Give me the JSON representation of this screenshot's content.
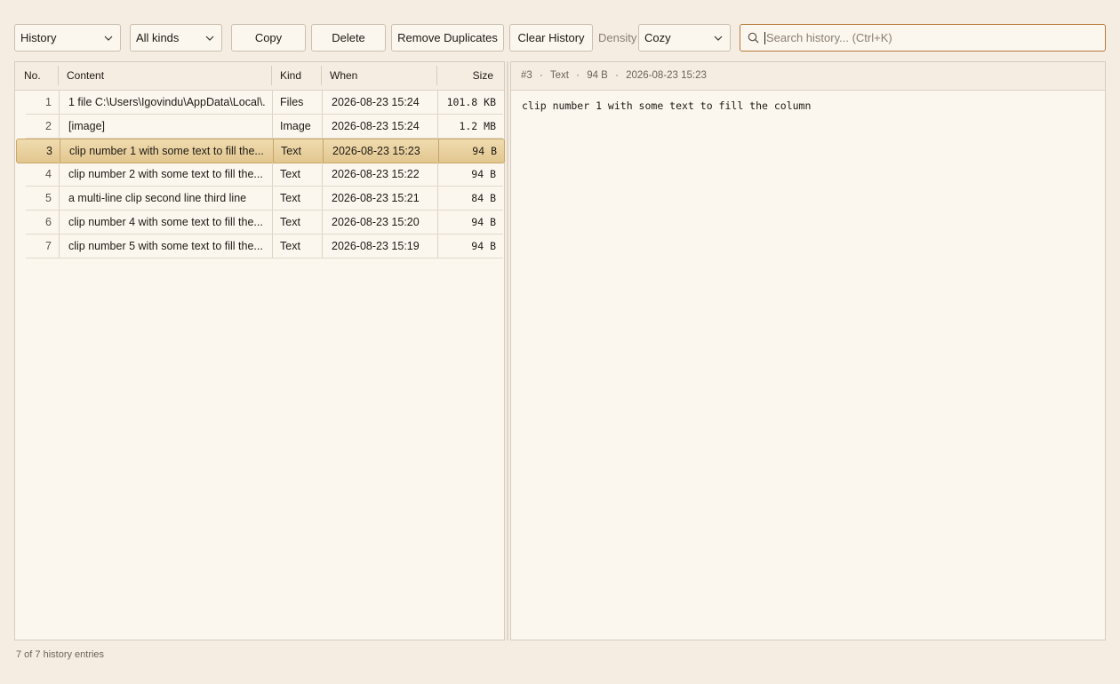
{
  "toolbar": {
    "view_select": "History",
    "kind_select": "All kinds",
    "copy_label": "Copy",
    "delete_label": "Delete",
    "remove_dup_label": "Remove Duplicates",
    "clear_label": "Clear History",
    "density_label": "Density",
    "density_select": "Cozy",
    "search_placeholder": "Search history... (Ctrl+K)"
  },
  "table": {
    "headers": [
      "No.",
      "Content",
      "Kind",
      "When",
      "Size"
    ],
    "rows": [
      {
        "no": "1",
        "content": "1 file C:\\Users\\Igovindu\\AppData\\Local\\...",
        "kind": "Files",
        "when": "2026-08-23 15:24",
        "size": "101.8 KB"
      },
      {
        "no": "2",
        "content": "[image]",
        "kind": "Image",
        "when": "2026-08-23 15:24",
        "size": "1.2 MB"
      },
      {
        "no": "3",
        "content": "clip number 1 with some text to fill the...",
        "kind": "Text",
        "when": "2026-08-23 15:23",
        "size": "94 B"
      },
      {
        "no": "4",
        "content": "clip number 2 with some text to fill the...",
        "kind": "Text",
        "when": "2026-08-23 15:22",
        "size": "94 B"
      },
      {
        "no": "5",
        "content": "a multi-line clip second line third line",
        "kind": "Text",
        "when": "2026-08-23 15:21",
        "size": "84 B"
      },
      {
        "no": "6",
        "content": "clip number 4 with some text to fill the...",
        "kind": "Text",
        "when": "2026-08-23 15:20",
        "size": "94 B"
      },
      {
        "no": "7",
        "content": "clip number 5 with some text to fill the...",
        "kind": "Text",
        "when": "2026-08-23 15:19",
        "size": "94 B"
      }
    ],
    "selected_index": 2
  },
  "detail": {
    "id": "#3",
    "kind": "Text",
    "size": "94 B",
    "when": "2026-08-23 15:23",
    "sep": "·",
    "content": "clip number 1 with some text to fill the column"
  },
  "status": "7 of 7 history entries",
  "icons": {
    "dropdown": "chevron-down-icon",
    "search": "search-icon"
  },
  "colors": {
    "accent": "#b67a3c",
    "selection": "#e8cf9c",
    "background": "#f5ede2"
  }
}
